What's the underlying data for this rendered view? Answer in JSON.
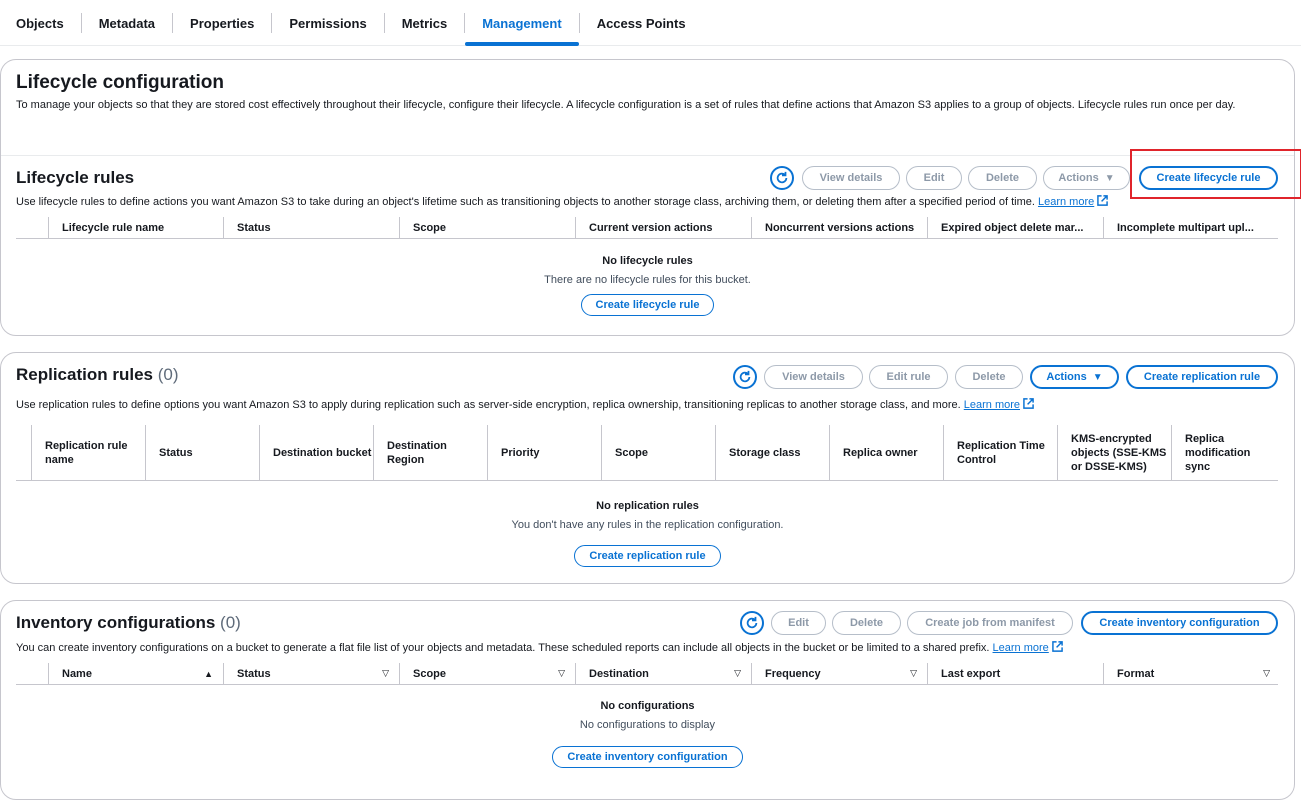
{
  "tabs": [
    {
      "label": "Objects",
      "active": false
    },
    {
      "label": "Metadata",
      "active": false
    },
    {
      "label": "Properties",
      "active": false
    },
    {
      "label": "Permissions",
      "active": false
    },
    {
      "label": "Metrics",
      "active": false
    },
    {
      "label": "Management",
      "active": true
    },
    {
      "label": "Access Points",
      "active": false
    }
  ],
  "lifecycle_config": {
    "title": "Lifecycle configuration",
    "description": "To manage your objects so that they are stored cost effectively throughout their lifecycle, configure their lifecycle. A lifecycle configuration is a set of rules that define actions that Amazon S3 applies to a group of objects. Lifecycle rules run once per day."
  },
  "lifecycle_rules": {
    "title": "Lifecycle rules",
    "description": "Use lifecycle rules to define actions you want Amazon S3 to take during an object's lifetime such as transitioning objects to another storage class, archiving them, or deleting them after a specified period of time.",
    "learn_more": "Learn more",
    "buttons": {
      "view_details": "View details",
      "edit": "Edit",
      "delete": "Delete",
      "actions": "Actions",
      "create": "Create lifecycle rule"
    },
    "columns": [
      "Lifecycle rule name",
      "Status",
      "Scope",
      "Current version actions",
      "Noncurrent versions actions",
      "Expired object delete mar...",
      "Incomplete multipart upl..."
    ],
    "empty_title": "No lifecycle rules",
    "empty_sub": "There are no lifecycle rules for this bucket.",
    "empty_button": "Create lifecycle rule"
  },
  "replication_rules": {
    "title": "Replication rules",
    "count": "(0)",
    "description": "Use replication rules to define options you want Amazon S3 to apply during replication such as server-side encryption, replica ownership, transitioning replicas to another storage class, and more.",
    "learn_more": "Learn more",
    "buttons": {
      "view_details": "View details",
      "edit": "Edit rule",
      "delete": "Delete",
      "actions": "Actions",
      "create": "Create replication rule"
    },
    "columns": [
      "Replication rule name",
      "Status",
      "Destination bucket",
      "Destination Region",
      "Priority",
      "Scope",
      "Storage class",
      "Replica owner",
      "Replication Time Control",
      "KMS-encrypted objects (SSE-KMS or DSSE-KMS)",
      "Replica modification sync"
    ],
    "empty_title": "No replication rules",
    "empty_sub": "You don't have any rules in the replication configuration.",
    "empty_button": "Create replication rule"
  },
  "inventory": {
    "title": "Inventory configurations",
    "count": "(0)",
    "description": "You can create inventory configurations on a bucket to generate a flat file list of your objects and metadata. These scheduled reports can include all objects in the bucket or be limited to a shared prefix.",
    "learn_more": "Learn more",
    "buttons": {
      "edit": "Edit",
      "delete": "Delete",
      "create_job": "Create job from manifest",
      "create": "Create inventory configuration"
    },
    "columns": [
      "Name",
      "Status",
      "Scope",
      "Destination",
      "Frequency",
      "Last export",
      "Format"
    ],
    "empty_title": "No configurations",
    "empty_sub": "No configurations to display",
    "empty_button": "Create inventory configuration"
  },
  "colors": {
    "accent": "#0972d3",
    "disabled": "#8d99a8",
    "highlight": "#e0242b"
  },
  "icons": {
    "refresh": "refresh-icon",
    "external": "external-link-icon",
    "caret": "caret-down-icon",
    "sort": "sort-icon"
  }
}
